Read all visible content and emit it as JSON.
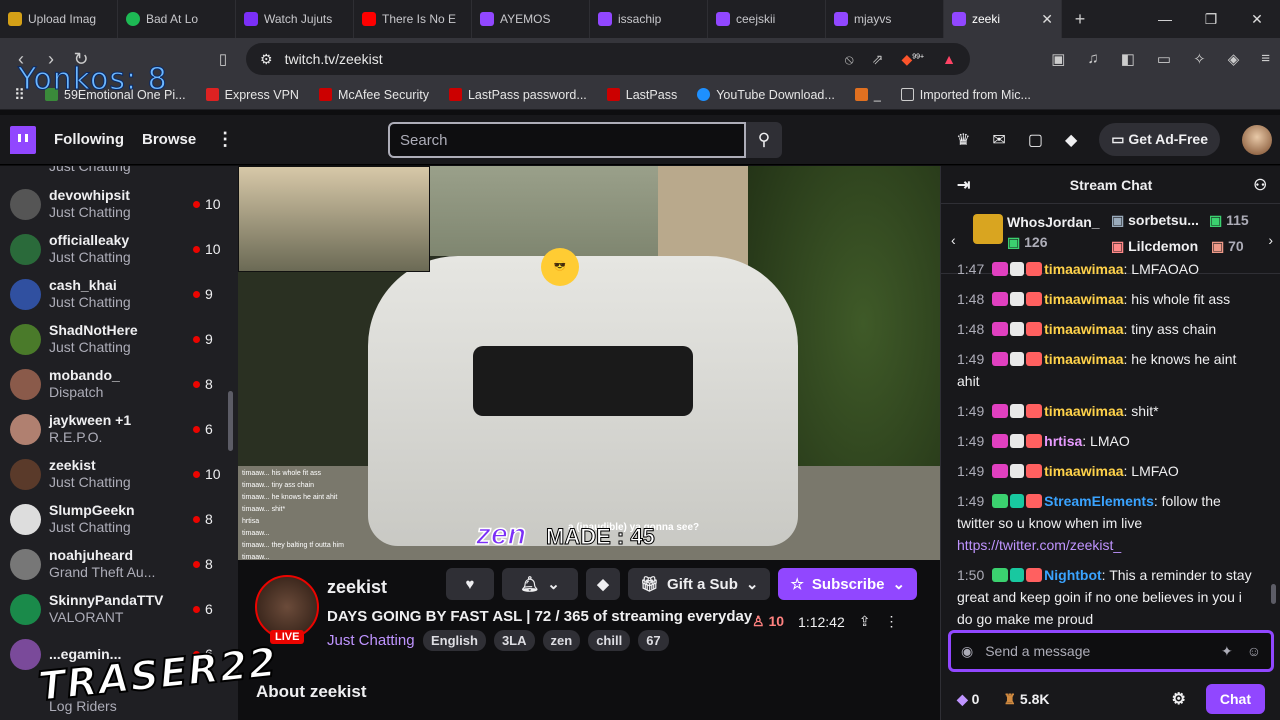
{
  "browser": {
    "tabs": [
      {
        "label": "Upload Imag",
        "color": "#d4a017"
      },
      {
        "label": "Bad At Lo",
        "color": "#1db954"
      },
      {
        "label": "Watch Jujuts",
        "color": "#7b2ff7"
      },
      {
        "label": "There Is No E",
        "color": "#ff0000"
      },
      {
        "label": "AYEMOS",
        "color": "#9147ff"
      },
      {
        "label": "issachip",
        "color": "#9147ff"
      },
      {
        "label": "ceejskii",
        "color": "#9147ff"
      },
      {
        "label": "mjayvs",
        "color": "#9147ff"
      },
      {
        "label": "zeeki",
        "color": "#9147ff",
        "active": true
      }
    ],
    "url": "twitch.tv/zeekist",
    "overlay_text": "Yonkos: 8",
    "ext_badge": "99+",
    "bookmarks": [
      {
        "label": "59Emotional One Pi...",
        "color": "#3a8a3a"
      },
      {
        "label": "Express VPN",
        "color": "#d22"
      },
      {
        "label": "McAfee Security",
        "color": "#c00"
      },
      {
        "label": "LastPass password...",
        "color": "#c00"
      },
      {
        "label": "LastPass",
        "color": "#c00"
      },
      {
        "label": "YouTube Download...",
        "color": "#1e90ff"
      },
      {
        "label": "_",
        "color": "#e07020"
      },
      {
        "label": "Imported from Mic...",
        "color": "#999"
      }
    ]
  },
  "nav": {
    "following": "Following",
    "browse": "Browse",
    "search_placeholder": "Search",
    "get_ad_free": "Get Ad-Free"
  },
  "sidebar": {
    "partial_top": "Just Chatting",
    "channels": [
      {
        "name": "devowhipsit",
        "category": "Just Chatting",
        "viewers": "10",
        "color": "#555"
      },
      {
        "name": "officialleaky",
        "category": "Just Chatting",
        "viewers": "10",
        "color": "#2a6a3a"
      },
      {
        "name": "cash_khai",
        "category": "Just Chatting",
        "viewers": "9",
        "color": "#3050a0"
      },
      {
        "name": "ShadNotHere",
        "category": "Just Chatting",
        "viewers": "9",
        "color": "#4a7a2a"
      },
      {
        "name": "mobando_",
        "category": "Dispatch",
        "viewers": "8",
        "color": "#8a5a4a"
      },
      {
        "name": "jaykween +1",
        "category": "R.E.P.O.",
        "viewers": "6",
        "color": "#b08070"
      },
      {
        "name": "zeekist",
        "category": "Just Chatting",
        "viewers": "10",
        "color": "#5a3a2a"
      },
      {
        "name": "SlumpGeekn",
        "category": "Just Chatting",
        "viewers": "8",
        "color": "#ddd"
      },
      {
        "name": "noahjuheard",
        "category": "Grand Theft Au...",
        "viewers": "8",
        "color": "#777"
      },
      {
        "name": "SkinnyPandaTTV",
        "category": "VALORANT",
        "viewers": "6",
        "color": "#1a8a4a"
      },
      {
        "name": "...egamin...",
        "category": "",
        "viewers": "6",
        "color": "#7a4a9a"
      }
    ],
    "partial_bottom": "Log Riders"
  },
  "video": {
    "overlay_chat": [
      "timaaw... his whole fit ass",
      "timaaw... tiny ass chain",
      "timaaw... he knows he aint ahit",
      "timaaw... shit*",
      "hrtisa",
      "timaaw...",
      "timaaw... they balting tf outta him",
      "timaaw..."
    ],
    "zen_text": "zen",
    "made_text": "MADE : 45",
    "caption": "a (inaudible) ya gonna see?"
  },
  "stream": {
    "streamer": "zeekist",
    "live": "LIVE",
    "title": "DAYS GOING BY FAST ASL | 72 / 365 of streaming everyday",
    "category": "Just Chatting",
    "tags": [
      "English",
      "3LA",
      "zen",
      "chill",
      "67"
    ],
    "gift_sub": "Gift a Sub",
    "subscribe": "Subscribe",
    "viewers": "10",
    "uptime": "1:12:42",
    "about": "About zeekist"
  },
  "chat": {
    "header": "Stream Chat",
    "leaderboard": [
      {
        "name": "WhosJordan_",
        "count": "126"
      },
      {
        "name": "sorbetsu...",
        "count": "115"
      },
      {
        "name": "Lilcdemon",
        "count": "70"
      }
    ],
    "messages": [
      {
        "time": "1:47",
        "user": "timaawimaa",
        "text": "LMFAOAO",
        "utype": "u1"
      },
      {
        "time": "1:48",
        "user": "timaawimaa",
        "text": "his whole fit ass",
        "utype": "u1"
      },
      {
        "time": "1:48",
        "user": "timaawimaa",
        "text": "tiny ass chain",
        "utype": "u1"
      },
      {
        "time": "1:49",
        "user": "timaawimaa",
        "text": "he knows he aint ahit",
        "utype": "u1"
      },
      {
        "time": "1:49",
        "user": "timaawimaa",
        "text": "shit*",
        "utype": "u1"
      },
      {
        "time": "1:49",
        "user": "hrtisa",
        "text": "LMAO",
        "utype": "u2"
      },
      {
        "time": "1:49",
        "user": "timaawimaa",
        "text": "LMFAO",
        "utype": "u1"
      },
      {
        "time": "1:49",
        "user": "StreamElements",
        "text": "follow the twitter so u know when im live",
        "utype": "u3",
        "link": "https://twitter.com/zeekist_"
      },
      {
        "time": "1:50",
        "user": "Nightbot",
        "text": "This a reminder to stay great and keep goin if no one believes in you i do go make me proud",
        "utype": "u3"
      }
    ],
    "input_placeholder": "Send a message",
    "bits": "0",
    "points": "5.8K",
    "chat_button": "Chat"
  },
  "watermark": "TRASER22"
}
